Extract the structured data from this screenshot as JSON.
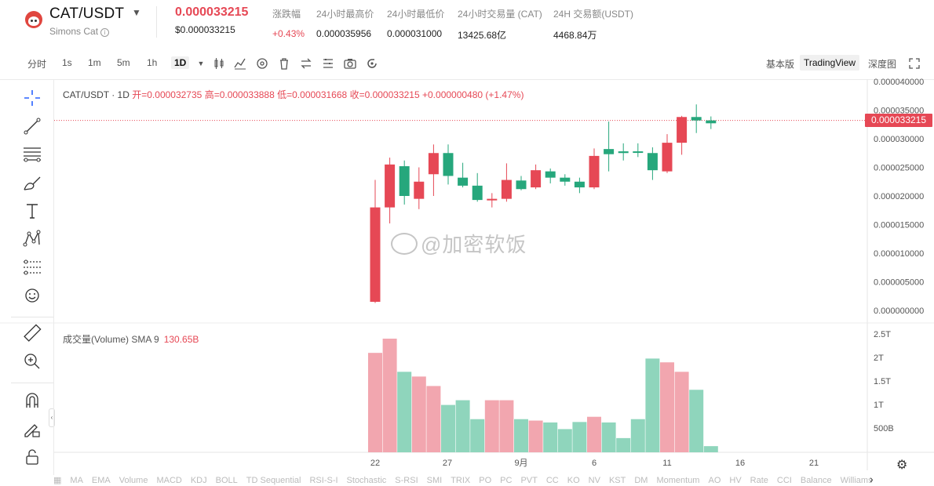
{
  "header": {
    "pair": "CAT/USDT",
    "subtitle": "Simons Cat",
    "price": "0.000033215",
    "price_usd": "$0.000033215",
    "stats": [
      {
        "label": "涨跌幅",
        "value": "+0.43%",
        "color": "red"
      },
      {
        "label": "24小时最高价",
        "value": "0.000035956"
      },
      {
        "label": "24小时最低价",
        "value": "0.000031000"
      },
      {
        "label": "24小时交易量 (CAT)",
        "value": "13425.68亿"
      },
      {
        "label": "24H 交易额(USDT)",
        "value": "4468.84万"
      }
    ]
  },
  "toolbar": {
    "intervals": [
      "分时",
      "1s",
      "1m",
      "5m",
      "1h",
      "1D"
    ],
    "active_interval": "1D",
    "views": [
      "基本版",
      "TradingView",
      "深度图"
    ],
    "active_view": "TradingView"
  },
  "legend": {
    "symbol": "CAT/USDT · 1D",
    "open": "开=0.000032735",
    "high": "高=0.000033888",
    "low": "低=0.000031668",
    "close": "收=0.000033215",
    "change": "+0.000000480 (+1.47%)"
  },
  "volume_legend": {
    "name": "成交量(Volume) SMA 9",
    "value": "130.65B"
  },
  "price_tag": "0.000033215",
  "watermark": "@加密软饭",
  "price_axis": [
    "0.000040000",
    "0.000035000",
    "0.000030000",
    "0.000025000",
    "0.000020000",
    "0.000015000",
    "0.000010000",
    "0.000005000",
    "0.000000000"
  ],
  "volume_axis": [
    "2.5T",
    "2T",
    "1.5T",
    "1T",
    "500B"
  ],
  "time_axis": [
    "22",
    "27",
    "9月",
    "6",
    "11",
    "16",
    "21"
  ],
  "indicators": [
    "MA",
    "EMA",
    "Volume",
    "MACD",
    "KDJ",
    "BOLL",
    "TD Sequential",
    "RSI-S-I",
    "Stochastic",
    "S-RSI",
    "SMI",
    "TRIX",
    "PO",
    "PC",
    "PVT",
    "CC",
    "KO",
    "NV",
    "KST",
    "DM",
    "Momentum",
    "AO",
    "HV",
    "Rate",
    "CCI",
    "Balance",
    "Williams"
  ],
  "colors": {
    "up": "#26a77c",
    "down": "#e64855",
    "up_vol": "#8fd5bc",
    "down_vol": "#f2a6af"
  },
  "chart_data": {
    "type": "candlestick",
    "title": "CAT/USDT · 1D",
    "ylim": [
      0,
      4e-05
    ],
    "x_ticks": [
      "22",
      "27",
      "9月",
      "6",
      "11",
      "16",
      "21"
    ],
    "candles": [
      {
        "o": 1.8e-05,
        "h": 2.28e-05,
        "l": 1.3e-06,
        "c": 1.5e-06,
        "v": 2.1
      },
      {
        "o": 2.55e-05,
        "h": 2.67e-05,
        "l": 1.52e-05,
        "c": 1.8e-05,
        "v": 2.4
      },
      {
        "o": 2e-05,
        "h": 2.62e-05,
        "l": 1.85e-05,
        "c": 2.52e-05,
        "v": 1.7
      },
      {
        "o": 2.25e-05,
        "h": 2.5e-05,
        "l": 1.77e-05,
        "c": 1.95e-05,
        "v": 1.6
      },
      {
        "o": 2.75e-05,
        "h": 2.9e-05,
        "l": 2e-05,
        "c": 2.38e-05,
        "v": 1.4
      },
      {
        "o": 2.35e-05,
        "h": 2.9e-05,
        "l": 2.2e-05,
        "c": 2.75e-05,
        "v": 1.0
      },
      {
        "o": 2.18e-05,
        "h": 2.58e-05,
        "l": 2.15e-05,
        "c": 2.32e-05,
        "v": 1.1
      },
      {
        "o": 1.93e-05,
        "h": 2.4e-05,
        "l": 1.9e-05,
        "c": 2.18e-05,
        "v": 0.7
      },
      {
        "o": 1.95e-05,
        "h": 2.05e-05,
        "l": 1.8e-05,
        "c": 1.93e-05,
        "v": 1.1
      },
      {
        "o": 2.28e-05,
        "h": 2.57e-05,
        "l": 1.9e-05,
        "c": 1.95e-05,
        "v": 1.1
      },
      {
        "o": 2.12e-05,
        "h": 2.35e-05,
        "l": 2.1e-05,
        "c": 2.27e-05,
        "v": 0.7
      },
      {
        "o": 2.45e-05,
        "h": 2.55e-05,
        "l": 2.12e-05,
        "c": 2.15e-05,
        "v": 0.67
      },
      {
        "o": 2.32e-05,
        "h": 2.48e-05,
        "l": 2.22e-05,
        "c": 2.43e-05,
        "v": 0.63
      },
      {
        "o": 2.25e-05,
        "h": 2.38e-05,
        "l": 2.18e-05,
        "c": 2.32e-05,
        "v": 0.49
      },
      {
        "o": 2.15e-05,
        "h": 2.32e-05,
        "l": 2.05e-05,
        "c": 2.25e-05,
        "v": 0.64
      },
      {
        "o": 2.7e-05,
        "h": 2.83e-05,
        "l": 2.12e-05,
        "c": 2.15e-05,
        "v": 0.75
      },
      {
        "o": 2.73e-05,
        "h": 3.3e-05,
        "l": 2.43e-05,
        "c": 2.82e-05,
        "v": 0.63
      },
      {
        "o": 2.75e-05,
        "h": 2.92e-05,
        "l": 2.62e-05,
        "c": 2.78e-05,
        "v": 0.3
      },
      {
        "o": 2.78e-05,
        "h": 2.92e-05,
        "l": 2.68e-05,
        "c": 2.78e-05,
        "v": 0.7
      },
      {
        "o": 2.45e-05,
        "h": 2.85e-05,
        "l": 2.28e-05,
        "c": 2.75e-05,
        "v": 1.98
      },
      {
        "o": 2.93e-05,
        "h": 3.08e-05,
        "l": 2.4e-05,
        "c": 2.43e-05,
        "v": 1.9
      },
      {
        "o": 3.38e-05,
        "h": 3.4e-05,
        "l": 2.72e-05,
        "c": 2.93e-05,
        "v": 1.7
      },
      {
        "o": 3.32e-05,
        "h": 3.6e-05,
        "l": 3.1e-05,
        "c": 3.38e-05,
        "v": 1.32
      },
      {
        "o": 3.27e-05,
        "h": 3.39e-05,
        "l": 3.17e-05,
        "c": 3.32e-05,
        "v": 0.13
      }
    ]
  }
}
